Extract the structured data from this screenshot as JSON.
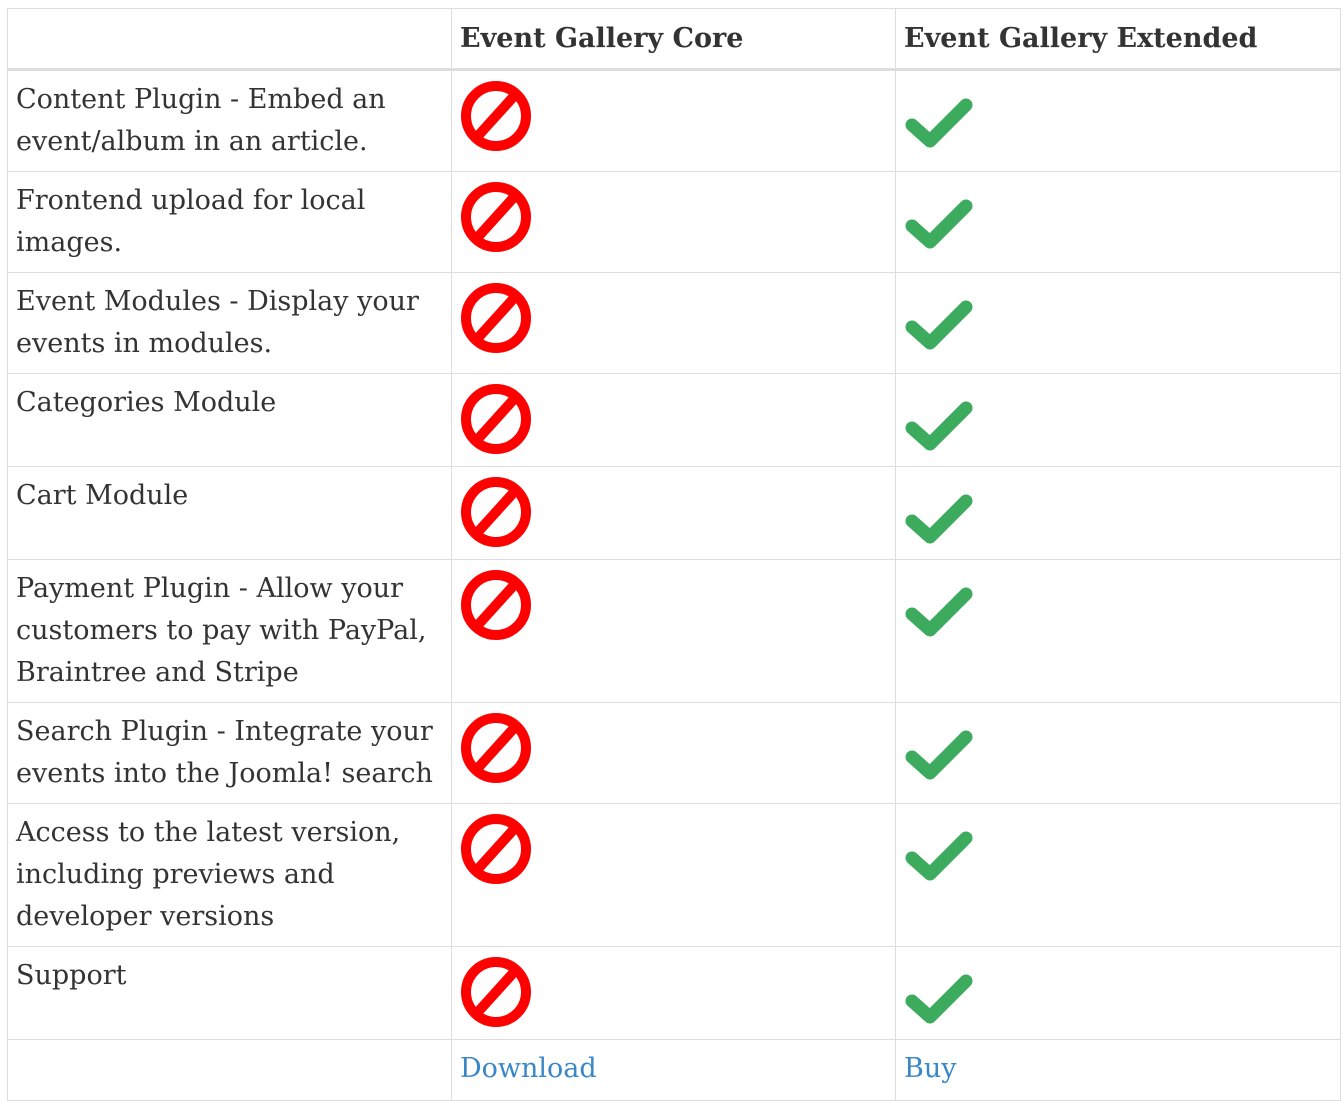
{
  "table": {
    "headers": [
      "",
      "Event Gallery Core",
      "Event Gallery Extended"
    ],
    "rows": [
      {
        "feature": "Content Plugin - Embed an event/album in an article.",
        "core": "no-icon",
        "extended": "check-icon"
      },
      {
        "feature": "Frontend upload for local images.",
        "core": "no-icon",
        "extended": "check-icon"
      },
      {
        "feature": "Event Modules - Display your events in modules.",
        "core": "no-icon",
        "extended": "check-icon"
      },
      {
        "feature": "Categories Module",
        "core": "no-icon",
        "extended": "check-icon"
      },
      {
        "feature": "Cart Module",
        "core": "no-icon",
        "extended": "check-icon"
      },
      {
        "feature": "Payment Plugin - Allow your customers to pay with PayPal, Braintree and Stripe",
        "core": "no-icon",
        "extended": "check-icon"
      },
      {
        "feature": "Search Plugin - Integrate your events into the Joomla! search",
        "core": "no-icon",
        "extended": "check-icon"
      },
      {
        "feature": "Access to the latest version, including previews and developer versions",
        "core": "no-icon",
        "extended": "check-icon"
      },
      {
        "feature": "Support",
        "core": "no-icon",
        "extended": "check-icon"
      }
    ],
    "footer": {
      "download_label": "Download",
      "buy_label": "Buy"
    }
  },
  "colors": {
    "no_icon": "#ff0000",
    "check_icon": "#3cab5e",
    "link": "#3a87c8",
    "border": "#dddddd"
  }
}
